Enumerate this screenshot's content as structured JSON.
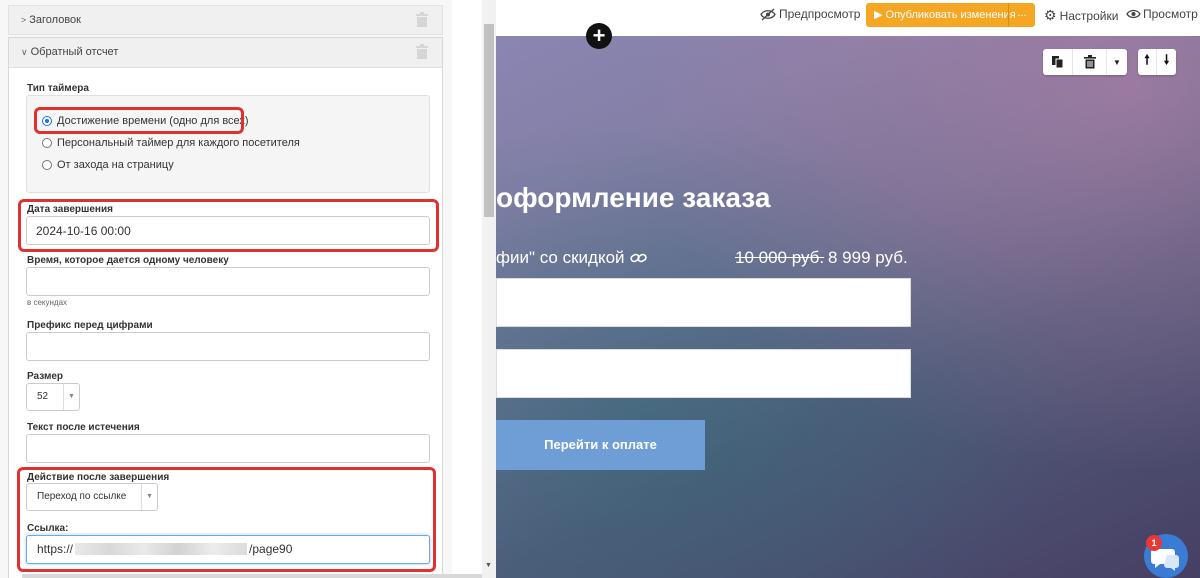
{
  "editor": {
    "sections": [
      {
        "title": "Заголовок",
        "collapsed": true
      },
      {
        "title": "Обратный отсчет",
        "collapsed": false
      }
    ],
    "timer_type": {
      "label": "Тип таймера",
      "options": [
        {
          "label": "Достижение времени (одно для всех)",
          "selected": true
        },
        {
          "label": "Персональный таймер для каждого посетителя",
          "selected": false
        },
        {
          "label": "От захода на страницу",
          "selected": false
        }
      ]
    },
    "end_date": {
      "label": "Дата завершения",
      "value": "2024-10-16 00:00"
    },
    "per_person": {
      "label": "Время, которое дается одному человеку",
      "value": "",
      "hint": "в секундах"
    },
    "prefix": {
      "label": "Префикс перед цифрами",
      "value": ""
    },
    "size": {
      "label": "Размер",
      "value": "52"
    },
    "after_text": {
      "label": "Текст после истечения",
      "value": ""
    },
    "action": {
      "label": "Действие после завершения",
      "value": "Переход по ссылке"
    },
    "link": {
      "label": "Ссылка:",
      "value_start": "https://",
      "value_end": "/page90"
    }
  },
  "toolbar": {
    "preview": "Предпросмотр",
    "publish": "Опубликовать изменения",
    "publish_more": "...",
    "settings": "Настройки",
    "view": "Просмотр"
  },
  "preview": {
    "heading": "оформление заказа",
    "product": "фии\" со скидкой",
    "old_price": "10 000 руб.",
    "new_price": "8 999 руб.",
    "pay_button": "Перейти к оплате"
  },
  "chat": {
    "badge": "1"
  },
  "colors": {
    "accent": "#f5a623",
    "highlight": "#e03131",
    "button": "#6f9ed6"
  }
}
